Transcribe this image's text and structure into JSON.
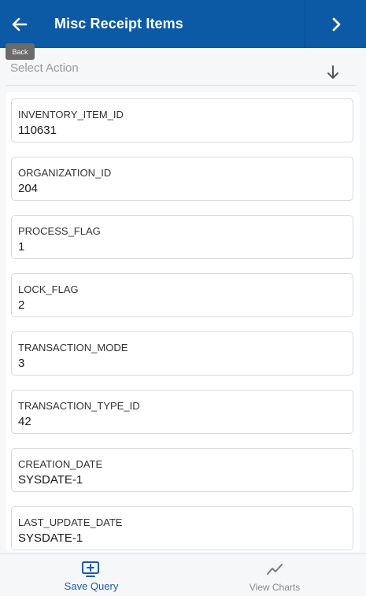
{
  "header": {
    "title": "Misc Receipt Items",
    "back_tooltip": "Back",
    "back_icon": "arrow-left-icon",
    "next_icon": "chevron-right-icon"
  },
  "action": {
    "placeholder": "Select Action",
    "icon": "arrow-down-icon"
  },
  "items": [
    {
      "label": "INVENTORY_ITEM_ID",
      "value": "110631"
    },
    {
      "label": "ORGANIZATION_ID",
      "value": "204"
    },
    {
      "label": "PROCESS_FLAG",
      "value": "1"
    },
    {
      "label": "LOCK_FLAG",
      "value": "2"
    },
    {
      "label": "TRANSACTION_MODE",
      "value": "3"
    },
    {
      "label": "TRANSACTION_TYPE_ID",
      "value": "42"
    },
    {
      "label": "CREATION_DATE",
      "value": "SYSDATE-1"
    },
    {
      "label": "LAST_UPDATE_DATE",
      "value": "SYSDATE-1"
    }
  ],
  "footer": {
    "save_query_label": "Save Query",
    "view_charts_label": "View Charts",
    "save_icon": "add-screen-icon",
    "charts_icon": "line-chart-icon"
  },
  "colors": {
    "header_bg": "#0c5aa6",
    "accent": "#1e5aa8",
    "muted": "#8a8a8a"
  }
}
